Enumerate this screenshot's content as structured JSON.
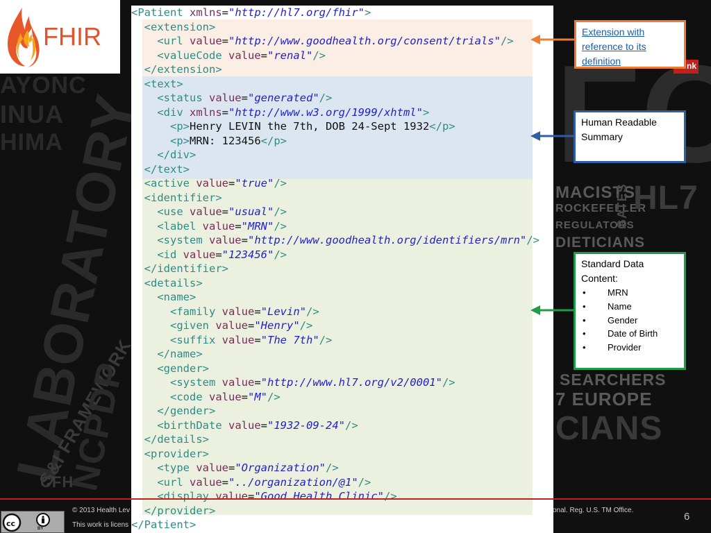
{
  "logo": {
    "text": "FHIR"
  },
  "code_lines": [
    [
      [
        "t",
        "<Patient "
      ],
      [
        "a",
        "xmlns"
      ],
      [
        "x",
        "="
      ],
      [
        "v",
        "\"http://hl7.org/fhir\""
      ],
      [
        "t",
        ">"
      ]
    ],
    [
      [
        "x",
        "  "
      ],
      [
        "t",
        "<extension>"
      ]
    ],
    [
      [
        "x",
        "    "
      ],
      [
        "t",
        "<url "
      ],
      [
        "a",
        "value"
      ],
      [
        "x",
        "="
      ],
      [
        "v",
        "\"http://www.goodhealth.org/consent/trials\""
      ],
      [
        "t",
        "/>"
      ]
    ],
    [
      [
        "x",
        "    "
      ],
      [
        "t",
        "<valueCode "
      ],
      [
        "a",
        "value"
      ],
      [
        "x",
        "="
      ],
      [
        "v",
        "\"renal\""
      ],
      [
        "t",
        "/>"
      ]
    ],
    [
      [
        "x",
        "  "
      ],
      [
        "t",
        "</extension>"
      ]
    ],
    [
      [
        "x",
        "  "
      ],
      [
        "t",
        "<text>"
      ]
    ],
    [
      [
        "x",
        "    "
      ],
      [
        "t",
        "<status "
      ],
      [
        "a",
        "value"
      ],
      [
        "x",
        "="
      ],
      [
        "v",
        "\"generated\""
      ],
      [
        "t",
        "/>"
      ]
    ],
    [
      [
        "x",
        "    "
      ],
      [
        "t",
        "<div "
      ],
      [
        "a",
        "xmlns"
      ],
      [
        "x",
        "="
      ],
      [
        "v",
        "\"http://www.w3.org/1999/xhtml\""
      ],
      [
        "t",
        ">"
      ]
    ],
    [
      [
        "x",
        "      "
      ],
      [
        "t",
        "<p>"
      ],
      [
        "x",
        "Henry LEVIN the 7th, DOB 24-Sept 1932"
      ],
      [
        "t",
        "</p>"
      ]
    ],
    [
      [
        "x",
        "      "
      ],
      [
        "t",
        "<p>"
      ],
      [
        "x",
        "MRN: 123456"
      ],
      [
        "t",
        "</p>"
      ]
    ],
    [
      [
        "x",
        "    "
      ],
      [
        "t",
        "</div>"
      ]
    ],
    [
      [
        "x",
        "  "
      ],
      [
        "t",
        "</text>"
      ]
    ],
    [
      [
        "x",
        "  "
      ],
      [
        "t",
        "<active "
      ],
      [
        "a",
        "value"
      ],
      [
        "x",
        "="
      ],
      [
        "v",
        "\"true\""
      ],
      [
        "t",
        "/>"
      ]
    ],
    [
      [
        "x",
        "  "
      ],
      [
        "t",
        "<identifier>"
      ]
    ],
    [
      [
        "x",
        "    "
      ],
      [
        "t",
        "<use "
      ],
      [
        "a",
        "value"
      ],
      [
        "x",
        "="
      ],
      [
        "v",
        "\"usual\""
      ],
      [
        "t",
        "/>"
      ]
    ],
    [
      [
        "x",
        "    "
      ],
      [
        "t",
        "<label "
      ],
      [
        "a",
        "value"
      ],
      [
        "x",
        "="
      ],
      [
        "v",
        "\"MRN\""
      ],
      [
        "t",
        "/>"
      ]
    ],
    [
      [
        "x",
        "    "
      ],
      [
        "t",
        "<system "
      ],
      [
        "a",
        "value"
      ],
      [
        "x",
        "="
      ],
      [
        "v",
        "\"http://www.goodhealth.org/identifiers/mrn\""
      ],
      [
        "t",
        "/>"
      ]
    ],
    [
      [
        "x",
        "    "
      ],
      [
        "t",
        "<id "
      ],
      [
        "a",
        "value"
      ],
      [
        "x",
        "="
      ],
      [
        "v",
        "\"123456\""
      ],
      [
        "t",
        "/>"
      ]
    ],
    [
      [
        "x",
        "  "
      ],
      [
        "t",
        "</identifier>"
      ]
    ],
    [
      [
        "x",
        "  "
      ],
      [
        "t",
        "<details>"
      ]
    ],
    [
      [
        "x",
        "    "
      ],
      [
        "t",
        "<name>"
      ]
    ],
    [
      [
        "x",
        "      "
      ],
      [
        "t",
        "<family "
      ],
      [
        "a",
        "value"
      ],
      [
        "x",
        "="
      ],
      [
        "v",
        "\"Levin\""
      ],
      [
        "t",
        "/>"
      ]
    ],
    [
      [
        "x",
        "      "
      ],
      [
        "t",
        "<given "
      ],
      [
        "a",
        "value"
      ],
      [
        "x",
        "="
      ],
      [
        "v",
        "\"Henry\""
      ],
      [
        "t",
        "/>"
      ]
    ],
    [
      [
        "x",
        "      "
      ],
      [
        "t",
        "<suffix "
      ],
      [
        "a",
        "value"
      ],
      [
        "x",
        "="
      ],
      [
        "v",
        "\"The 7th\""
      ],
      [
        "t",
        "/>"
      ]
    ],
    [
      [
        "x",
        "    "
      ],
      [
        "t",
        "</name>"
      ]
    ],
    [
      [
        "x",
        "    "
      ],
      [
        "t",
        "<gender>"
      ]
    ],
    [
      [
        "x",
        "      "
      ],
      [
        "t",
        "<system "
      ],
      [
        "a",
        "value"
      ],
      [
        "x",
        "="
      ],
      [
        "v",
        "\"http://www.hl7.org/v2/0001\""
      ],
      [
        "t",
        "/>"
      ]
    ],
    [
      [
        "x",
        "      "
      ],
      [
        "t",
        "<code "
      ],
      [
        "a",
        "value"
      ],
      [
        "x",
        "="
      ],
      [
        "v",
        "\"M\""
      ],
      [
        "t",
        "/>"
      ]
    ],
    [
      [
        "x",
        "    "
      ],
      [
        "t",
        "</gender>"
      ]
    ],
    [
      [
        "x",
        "    "
      ],
      [
        "t",
        "<birthDate "
      ],
      [
        "a",
        "value"
      ],
      [
        "x",
        "="
      ],
      [
        "v",
        "\"1932-09-24\""
      ],
      [
        "t",
        "/>"
      ]
    ],
    [
      [
        "x",
        "  "
      ],
      [
        "t",
        "</details>"
      ]
    ],
    [
      [
        "x",
        "  "
      ],
      [
        "t",
        "<provider>"
      ]
    ],
    [
      [
        "x",
        "    "
      ],
      [
        "t",
        "<type "
      ],
      [
        "a",
        "value"
      ],
      [
        "x",
        "="
      ],
      [
        "v",
        "\"Organization\""
      ],
      [
        "t",
        "/>"
      ]
    ],
    [
      [
        "x",
        "    "
      ],
      [
        "t",
        "<url "
      ],
      [
        "a",
        "value"
      ],
      [
        "x",
        "="
      ],
      [
        "v",
        "\"../organization/@1\""
      ],
      [
        "t",
        "/>"
      ]
    ],
    [
      [
        "x",
        "    "
      ],
      [
        "t",
        "<display "
      ],
      [
        "a",
        "value"
      ],
      [
        "x",
        "="
      ],
      [
        "v",
        "\"Good Health Clinic\""
      ],
      [
        "t",
        "/>"
      ]
    ],
    [
      [
        "x",
        "  "
      ],
      [
        "t",
        "</provider>"
      ]
    ],
    [
      [
        "t",
        "</Patient>"
      ]
    ]
  ],
  "callouts": {
    "extension": {
      "lines": [
        "Extension with",
        "reference to its",
        "definition"
      ],
      "color": "#ed7d31"
    },
    "human_readable": {
      "lines": [
        "Human Readable",
        "Summary"
      ],
      "color": "#2f5ea8"
    },
    "standard_data": {
      "title_lines": [
        "Standard Data",
        "Content:"
      ],
      "items": [
        "MRN",
        "Name",
        "Gender",
        "Date of Birth",
        "Provider"
      ],
      "color": "#1e9c47"
    }
  },
  "red_tag_text": "nk",
  "footer": {
    "copyright_left": "© 2013 Health Lev",
    "copyright_right": "onal. Reg. U.S. TM Office.",
    "license_left": "This work is licens",
    "page_number": "6",
    "cc_by": "BY"
  },
  "background_words": [
    "AYONC",
    "INUA",
    "HIMA",
    "MACISTS",
    "ROCKEFELLER",
    "REGULATORS",
    "GATES",
    "HL7",
    "DIETICIANS",
    "SEARCHERS",
    "7 EUROPE",
    "CIANS",
    "LABORATORY",
    "S&I FRAMEWORK",
    "NCPDP",
    "CFH",
    "FO"
  ],
  "colors": {
    "tag": "#2e8b87",
    "attr": "#7a2a5a",
    "value": "#1f1fd0",
    "extension_band": "#fbeee4",
    "text_band": "#dce6f1",
    "data_band": "#ebf1de",
    "footer_line": "#c0201c"
  }
}
